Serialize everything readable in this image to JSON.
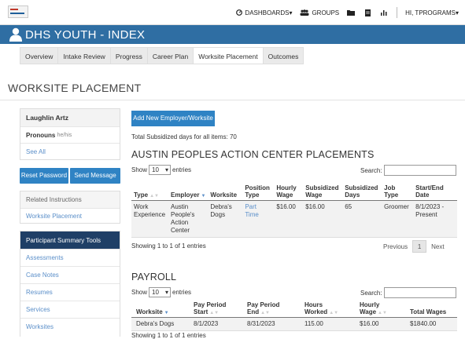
{
  "topnav": {
    "logo_name": "org-logo",
    "dashboards": "DASHBOARDS",
    "groups": "GROUPS",
    "user": "HI, TPROGRAMS"
  },
  "banner": {
    "title": "DHS YOUTH - INDEX"
  },
  "tabs": [
    "Overview",
    "Intake Review",
    "Progress",
    "Career Plan",
    "Worksite Placement",
    "Outcomes"
  ],
  "page_title": "WORKSITE PLACEMENT",
  "participant": {
    "name": "Laughlin Artz",
    "pronouns_label": "Pronouns",
    "pronouns_value": "he/his",
    "see_all": "See All"
  },
  "buttons": {
    "reset_password": "Reset Password",
    "send_message": "Send Message",
    "add_employer": "Add New Employer/Worksite"
  },
  "related": {
    "header": "Related Instructions",
    "link": "Worksite Placement"
  },
  "tools": {
    "header": "Participant Summary Tools",
    "items": [
      "Assessments",
      "Case Notes",
      "Resumes",
      "Services",
      "Worksites"
    ]
  },
  "summary_text": "Total Subsidized days for all items: 70",
  "placements": {
    "title": "AUSTIN PEOPLES ACTION CENTER PLACEMENTS",
    "show": "Show",
    "entries_value": "10",
    "entries": "entries",
    "search": "Search:",
    "headers": [
      "Type",
      "Employer",
      "Worksite",
      "Position Type",
      "Hourly Wage",
      "Subsidized Wage",
      "Subsidized Days",
      "Job Type",
      "Start/End Date"
    ],
    "rows": [
      [
        "Work Experience",
        "Austin People's Action Center",
        "Debra's Dogs",
        "Part Time",
        "$16.00",
        "$16.00",
        "65",
        "Groomer",
        "8/1/2023 - Present"
      ]
    ],
    "showing": "Showing 1 to 1 of 1 entries",
    "prev": "Previous",
    "page": "1",
    "next": "Next"
  },
  "payroll": {
    "title": "PAYROLL",
    "show": "Show",
    "entries_value": "10",
    "entries": "entries",
    "search": "Search:",
    "headers": [
      "Worksite",
      "Pay Period Start",
      "Pay Period End",
      "Hours Worked",
      "Hourly Wage",
      "Total Wages"
    ],
    "rows": [
      [
        "Debra's Dogs",
        "8/1/2023",
        "8/31/2023",
        "115.00",
        "$16.00",
        "$1840.00"
      ]
    ],
    "showing": "Showing 1 to 1 of 1 entries"
  },
  "colors": {
    "primary": "#2f83c4",
    "banner": "#2f6ea3",
    "dark_panel": "#1f3f66",
    "link": "#5b8fc9"
  }
}
